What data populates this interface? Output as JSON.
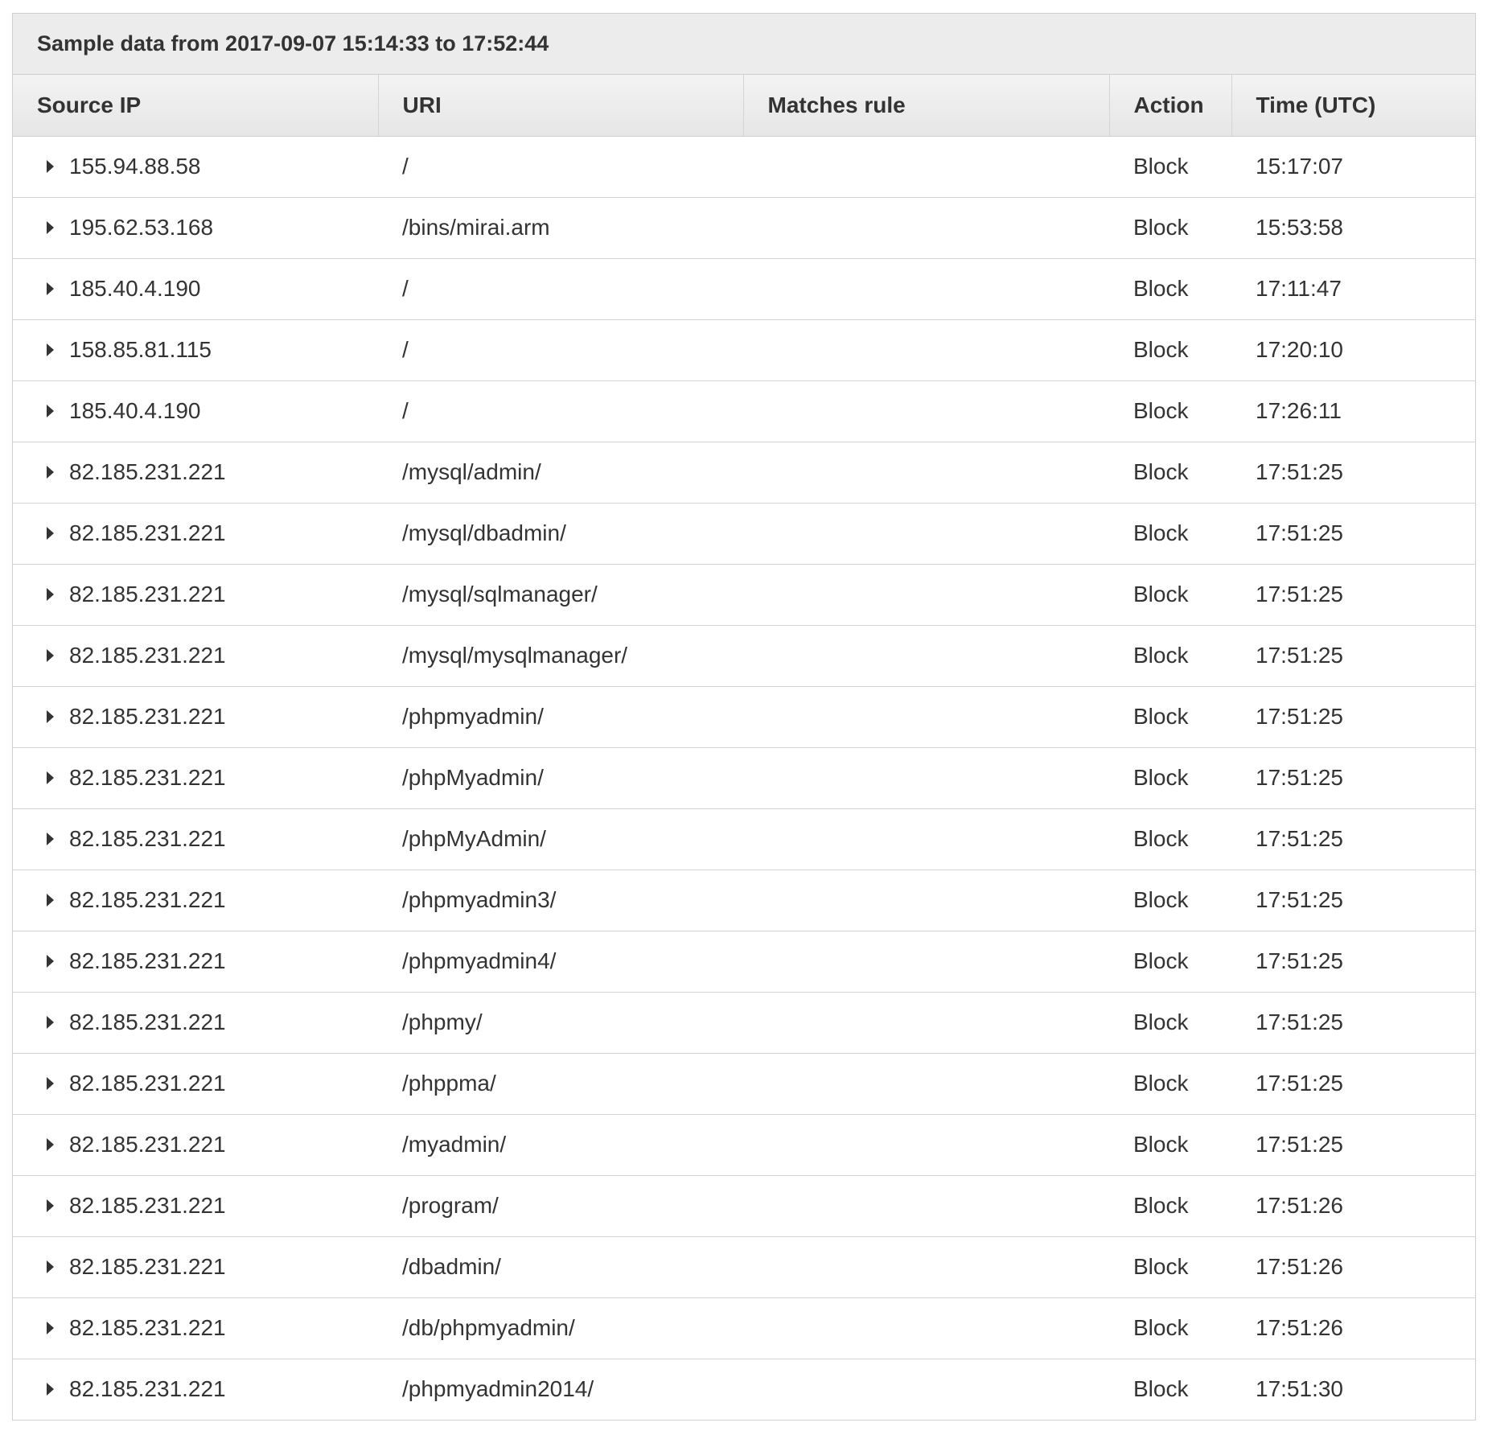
{
  "panel": {
    "title": "Sample data from 2017-09-07 15:14:33 to 17:52:44"
  },
  "table": {
    "columns": [
      {
        "label": "Source IP"
      },
      {
        "label": "URI"
      },
      {
        "label": "Matches rule"
      },
      {
        "label": "Action"
      },
      {
        "label": "Time (UTC)"
      }
    ],
    "rows": [
      {
        "ip": "155.94.88.58",
        "uri": "/",
        "rule": "",
        "action": "Block",
        "time": "15:17:07"
      },
      {
        "ip": "195.62.53.168",
        "uri": "/bins/mirai.arm",
        "rule": "",
        "action": "Block",
        "time": "15:53:58"
      },
      {
        "ip": "185.40.4.190",
        "uri": "/",
        "rule": "",
        "action": "Block",
        "time": "17:11:47"
      },
      {
        "ip": "158.85.81.115",
        "uri": "/",
        "rule": "",
        "action": "Block",
        "time": "17:20:10"
      },
      {
        "ip": "185.40.4.190",
        "uri": "/",
        "rule": "",
        "action": "Block",
        "time": "17:26:11"
      },
      {
        "ip": "82.185.231.221",
        "uri": "/mysql/admin/",
        "rule": "",
        "action": "Block",
        "time": "17:51:25"
      },
      {
        "ip": "82.185.231.221",
        "uri": "/mysql/dbadmin/",
        "rule": "",
        "action": "Block",
        "time": "17:51:25"
      },
      {
        "ip": "82.185.231.221",
        "uri": "/mysql/sqlmanager/",
        "rule": "",
        "action": "Block",
        "time": "17:51:25"
      },
      {
        "ip": "82.185.231.221",
        "uri": "/mysql/mysqlmanager/",
        "rule": "",
        "action": "Block",
        "time": "17:51:25"
      },
      {
        "ip": "82.185.231.221",
        "uri": "/phpmyadmin/",
        "rule": "",
        "action": "Block",
        "time": "17:51:25"
      },
      {
        "ip": "82.185.231.221",
        "uri": "/phpMyadmin/",
        "rule": "",
        "action": "Block",
        "time": "17:51:25"
      },
      {
        "ip": "82.185.231.221",
        "uri": "/phpMyAdmin/",
        "rule": "",
        "action": "Block",
        "time": "17:51:25"
      },
      {
        "ip": "82.185.231.221",
        "uri": "/phpmyadmin3/",
        "rule": "",
        "action": "Block",
        "time": "17:51:25"
      },
      {
        "ip": "82.185.231.221",
        "uri": "/phpmyadmin4/",
        "rule": "",
        "action": "Block",
        "time": "17:51:25"
      },
      {
        "ip": "82.185.231.221",
        "uri": "/phpmy/",
        "rule": "",
        "action": "Block",
        "time": "17:51:25"
      },
      {
        "ip": "82.185.231.221",
        "uri": "/phppma/",
        "rule": "",
        "action": "Block",
        "time": "17:51:25"
      },
      {
        "ip": "82.185.231.221",
        "uri": "/myadmin/",
        "rule": "",
        "action": "Block",
        "time": "17:51:25"
      },
      {
        "ip": "82.185.231.221",
        "uri": "/program/",
        "rule": "",
        "action": "Block",
        "time": "17:51:26"
      },
      {
        "ip": "82.185.231.221",
        "uri": "/dbadmin/",
        "rule": "",
        "action": "Block",
        "time": "17:51:26"
      },
      {
        "ip": "82.185.231.221",
        "uri": "/db/phpmyadmin/",
        "rule": "",
        "action": "Block",
        "time": "17:51:26"
      },
      {
        "ip": "82.185.231.221",
        "uri": "/phpmyadmin2014/",
        "rule": "",
        "action": "Block",
        "time": "17:51:30"
      }
    ]
  },
  "icons": {
    "row_expand": "caret-right-icon"
  },
  "colors": {
    "header_bg": "#ececec",
    "border": "#cfcfcf",
    "text": "#333333"
  }
}
